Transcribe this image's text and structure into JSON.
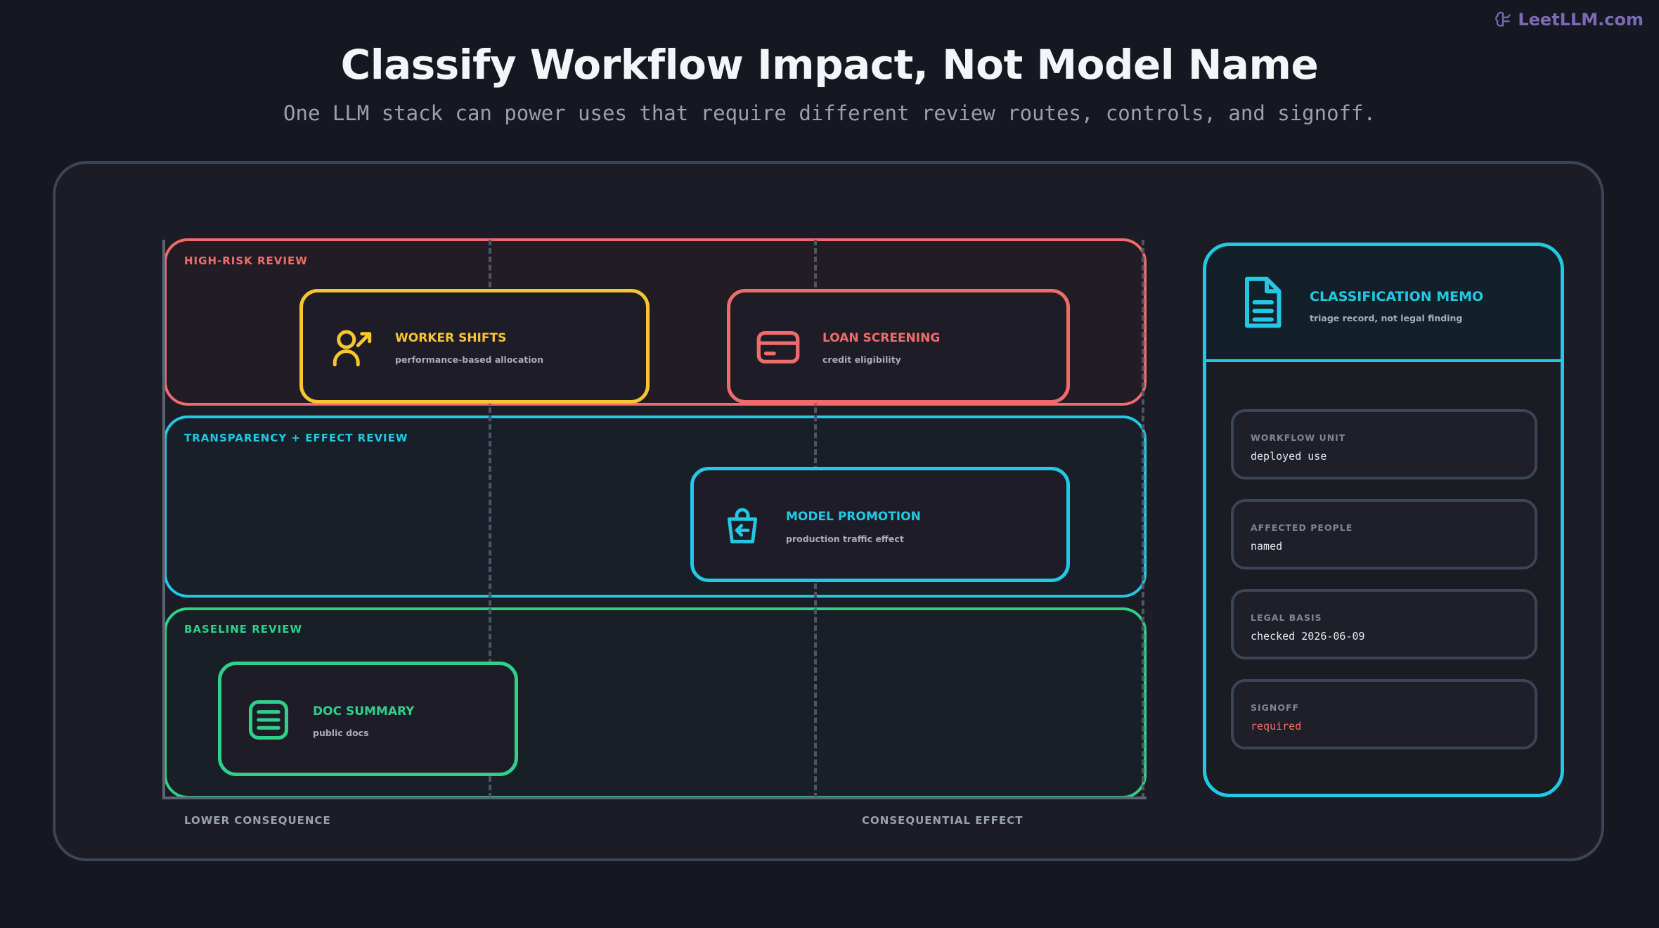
{
  "brand": {
    "label": "LeetLLM.com",
    "icon": "brain-logo-icon"
  },
  "title": "Classify Workflow Impact, Not Model Name",
  "subtitle": "One LLM stack can power uses that require different review routes, controls, and signoff.",
  "bands": {
    "high": {
      "label": "HIGH-RISK REVIEW",
      "color": "#F06C6C"
    },
    "transparency": {
      "label": "TRANSPARENCY + EFFECT REVIEW",
      "color": "#22C8E5"
    },
    "baseline": {
      "label": "BASELINE REVIEW",
      "color": "#2FD08A"
    }
  },
  "cards": {
    "worker_shifts": {
      "title": "WORKER SHIFTS",
      "subtitle": "performance-based allocation",
      "icon": "user-arrow-icon",
      "color": "#F7C531"
    },
    "loan_screening": {
      "title": "LOAN SCREENING",
      "subtitle": "credit eligibility",
      "icon": "credit-card-icon",
      "color": "#F06C6C"
    },
    "model_promotion": {
      "title": "MODEL PROMOTION",
      "subtitle": "production traffic effect",
      "icon": "shopping-bag-icon",
      "color": "#22C8E5"
    },
    "doc_summary": {
      "title": "DOC SUMMARY",
      "subtitle": "public docs",
      "icon": "text-lines-icon",
      "color": "#2FD08A"
    }
  },
  "axis": {
    "left_label": "LOWER CONSEQUENCE",
    "right_label": "CONSEQUENTIAL EFFECT"
  },
  "memo": {
    "title": "CLASSIFICATION MEMO",
    "subtitle": "triage record, not legal finding",
    "icon": "document-icon",
    "color": "#22C8E5",
    "fields": [
      {
        "label": "WORKFLOW UNIT",
        "value": "deployed use",
        "color": "#E6E8EE"
      },
      {
        "label": "AFFECTED PEOPLE",
        "value": "named",
        "color": "#E6E8EE"
      },
      {
        "label": "LEGAL BASIS",
        "value": "checked 2026-06-09",
        "color": "#E6E8EE"
      },
      {
        "label": "SIGNOFF",
        "value": "required",
        "color": "#F06C6C"
      }
    ]
  }
}
